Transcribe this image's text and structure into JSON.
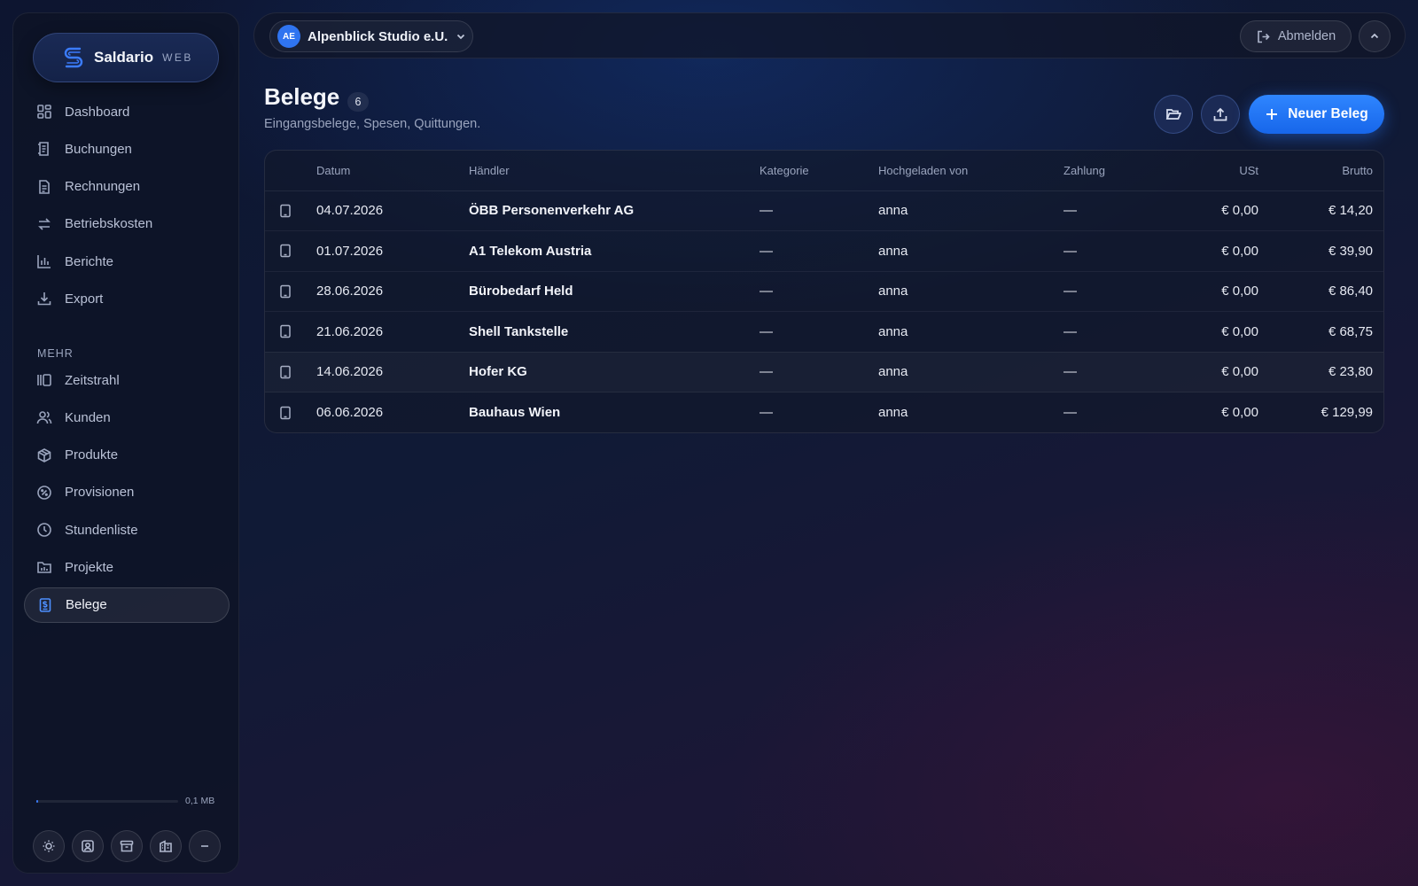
{
  "brand": {
    "name": "Saldario",
    "sub": "WEB",
    "accent": "#3b7cff"
  },
  "sidebar": {
    "main_items": [
      {
        "label": "Dashboard",
        "icon": "dashboard-icon"
      },
      {
        "label": "Buchungen",
        "icon": "ledger-icon"
      },
      {
        "label": "Rechnungen",
        "icon": "invoice-icon"
      },
      {
        "label": "Betriebskosten",
        "icon": "transfer-icon"
      },
      {
        "label": "Berichte",
        "icon": "bar-chart-icon"
      },
      {
        "label": "Export",
        "icon": "download-icon"
      }
    ],
    "section_label": "MEHR",
    "more_items": [
      {
        "label": "Zeitstrahl",
        "icon": "timeline-icon"
      },
      {
        "label": "Kunden",
        "icon": "users-icon"
      },
      {
        "label": "Produkte",
        "icon": "box-icon"
      },
      {
        "label": "Provisionen",
        "icon": "percent-icon"
      },
      {
        "label": "Stundenliste",
        "icon": "clock-icon"
      },
      {
        "label": "Projekte",
        "icon": "folder-chart-icon"
      },
      {
        "label": "Belege",
        "icon": "receipt-icon",
        "active": true
      }
    ],
    "storage": {
      "used_label": "0,1 MB",
      "fill_fraction": 0.01
    }
  },
  "topbar": {
    "company_initials": "AE",
    "company_name": "Alpenblick Studio e.U.",
    "logout_label": "Abmelden"
  },
  "page": {
    "title": "Belege",
    "count": "6",
    "subtitle": "Eingangsbelege, Spesen, Quittungen.",
    "new_button_label": "Neuer Beleg"
  },
  "table": {
    "columns": [
      "Datum",
      "Händler",
      "Kategorie",
      "Hochgeladen von",
      "Zahlung",
      "USt",
      "Brutto"
    ],
    "rows": [
      {
        "date": "04.07.2026",
        "merchant": "ÖBB Personenverkehr AG",
        "category": "—",
        "uploaded_by": "anna",
        "payment": "—",
        "vat": "€ 0,00",
        "gross": "€ 14,20"
      },
      {
        "date": "01.07.2026",
        "merchant": "A1 Telekom Austria",
        "category": "—",
        "uploaded_by": "anna",
        "payment": "—",
        "vat": "€ 0,00",
        "gross": "€ 39,90"
      },
      {
        "date": "28.06.2026",
        "merchant": "Bürobedarf Held",
        "category": "—",
        "uploaded_by": "anna",
        "payment": "—",
        "vat": "€ 0,00",
        "gross": "€ 86,40"
      },
      {
        "date": "21.06.2026",
        "merchant": "Shell Tankstelle",
        "category": "—",
        "uploaded_by": "anna",
        "payment": "—",
        "vat": "€ 0,00",
        "gross": "€ 68,75"
      },
      {
        "date": "14.06.2026",
        "merchant": "Hofer KG",
        "category": "—",
        "uploaded_by": "anna",
        "payment": "—",
        "vat": "€ 0,00",
        "gross": "€ 23,80"
      },
      {
        "date": "06.06.2026",
        "merchant": "Bauhaus Wien",
        "category": "—",
        "uploaded_by": "anna",
        "payment": "—",
        "vat": "€ 0,00",
        "gross": "€ 129,99"
      }
    ]
  }
}
